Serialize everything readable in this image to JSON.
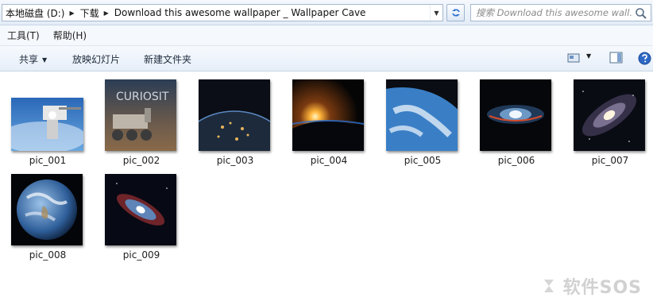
{
  "address": {
    "crumbs": [
      {
        "label": "本地磁盘 (D:)"
      },
      {
        "label": "下载"
      },
      {
        "label": "Download this awesome wallpaper _ Wallpaper Cave"
      }
    ]
  },
  "search": {
    "placeholder": "搜索 Download this awesome wall..."
  },
  "menu": [
    {
      "label": "工具(T)"
    },
    {
      "label": "帮助(H)"
    }
  ],
  "toolbar": {
    "share_label": "共享",
    "slideshow_label": "放映幻灯片",
    "new_folder_label": "新建文件夹"
  },
  "files": [
    {
      "name": "pic_001",
      "icon": "astronaut-spacewalk"
    },
    {
      "name": "pic_002",
      "icon": "curiosity-rover"
    },
    {
      "name": "pic_003",
      "icon": "earth-night-lights"
    },
    {
      "name": "pic_004",
      "icon": "sunrise-over-earth"
    },
    {
      "name": "pic_005",
      "icon": "earth-clouds"
    },
    {
      "name": "pic_006",
      "icon": "sombrero-galaxy"
    },
    {
      "name": "pic_007",
      "icon": "andromeda-galaxy"
    },
    {
      "name": "pic_008",
      "icon": "earth-globe"
    },
    {
      "name": "pic_009",
      "icon": "starburst-galaxy"
    }
  ],
  "thumb_texts": {
    "pic_002_caption": "CURIOSIT"
  },
  "watermark": {
    "text": "软件SOS"
  },
  "colors": {
    "chrome": "#e3ecf7",
    "border": "#a8b8cc",
    "text": "#1e1e1e"
  }
}
